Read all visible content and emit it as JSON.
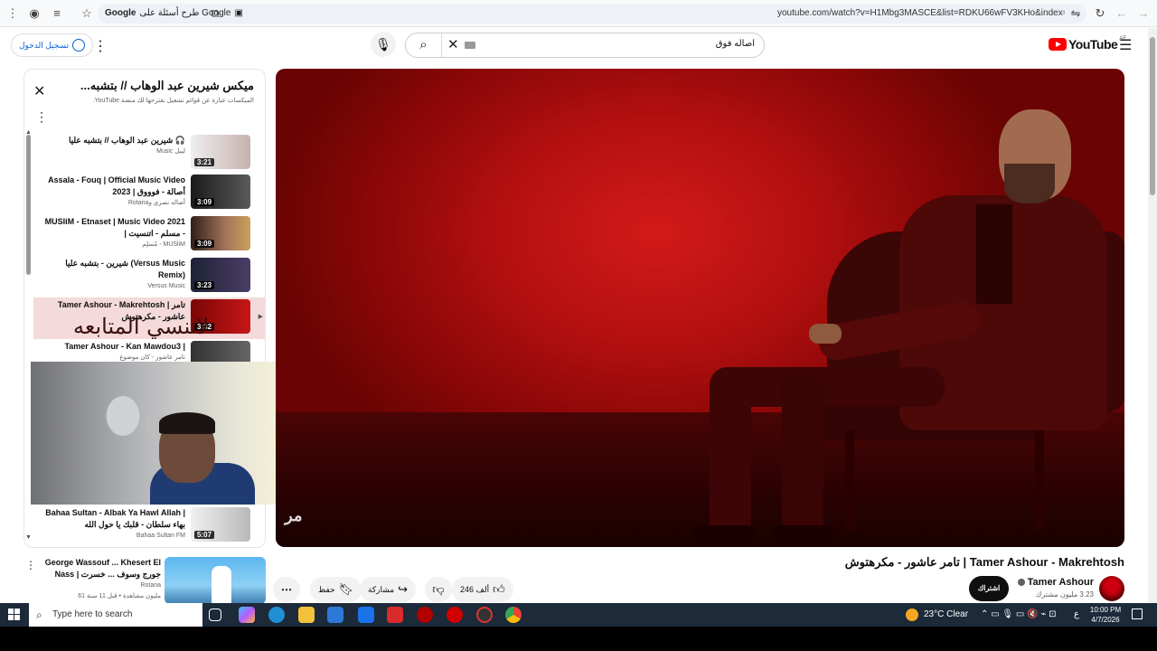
{
  "browser": {
    "search_chip": "طرح أسئلة على Google",
    "url": "youtube.com/watch?v=H1Mbg3MASCE&list=RDKU66wFV3KHo&index=5"
  },
  "header": {
    "signin_label": "تسجيل الدخول",
    "search_value": "اصاله فوق",
    "logo_text": "YouTube",
    "country_code": "AE"
  },
  "playlist": {
    "title": "ميكس شيرين عبد الوهاب // بتشبه...",
    "subtitle": "الميكسات عبارة عن قوائم تشغيل نقترحها لك منصة YouTube.",
    "items": [
      {
        "title": "شيرين عبد الوهاب // بتشبه عليا 🎧",
        "channel": "ليبل Music",
        "duration": "3:21",
        "thumb_color": "#d9c7c2"
      },
      {
        "title": "Assala - Fouq | Official Music Video 2023 | أصالة - فوووق",
        "channel": "أصاله نصري وRotana",
        "duration": "3:09",
        "thumb_color": "#3b3b3b"
      },
      {
        "title": "MUSliM - Etnaset | Music Video 2021 | مسلم - اتنسيت -",
        "channel": "MUSliM - مُسلِم",
        "duration": "3:09",
        "thumb_color": "#6b4a3a"
      },
      {
        "title": "شيرين - بتشبه عليا (Versus Music Remix)",
        "channel": "Versus Music",
        "duration": "3:23",
        "thumb_color": "#2f3448"
      },
      {
        "title": "Tamer Ashour - Makrehtosh | تامر عاشور - مكرهتوش",
        "channel": "",
        "duration": "3:32",
        "thumb_color": "#b10d0d"
      },
      {
        "title": "Tamer Ashour - Kan Mawdou3 |",
        "channel": "تامر عاشور - كان موضوع",
        "duration": "",
        "thumb_color": "#444444"
      },
      {
        "title": "Bahaa Sultan - Albak Ya Hawl Allah | بهاء سلطان - قلبك يا حول الله",
        "channel": "Bahaa Sultan FM",
        "duration": "5:07",
        "thumb_color": "#d9d9d9"
      }
    ],
    "overlay_text": "لاتنسي المتابعه"
  },
  "video": {
    "title": "تامر عاشور - مكرهتوش | Tamer Ashour - Makrehtosh",
    "channel": "Tamer Ashour",
    "subscribers": "3.23 مليون مشترك",
    "subscribe_label": "اشتراك",
    "likes": "246 ألف",
    "share_label": "مشاركة",
    "save_label": "حفظ",
    "watermark": "ﻣﺮ"
  },
  "recommendation": {
    "title": "George Wassouf ... Khesert El Nass | جورج وسوف ... خسرت",
    "channel": "Rotana",
    "meta": "61 مليون مشاهدة • قبل 11 سنة"
  },
  "taskbar": {
    "search_placeholder": "Type here to search",
    "weather": "23°C  Clear",
    "lang": "ع",
    "time": "10:00 PM",
    "date": "4/7/2026"
  }
}
